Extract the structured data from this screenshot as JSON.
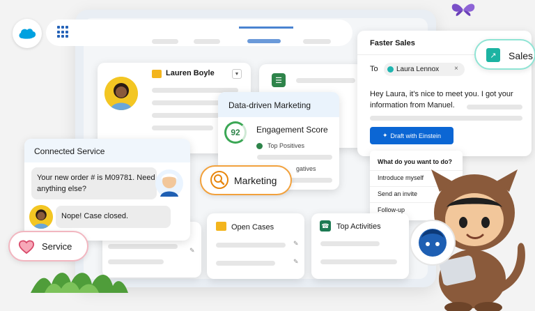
{
  "contact": {
    "name": "Lauren Boyle"
  },
  "marketing_card": {
    "title": "Data-driven Marketing",
    "score": "92",
    "score_label": "Engagement Score",
    "positives_label": "Top Positives",
    "negatives_label": "gatives"
  },
  "sales_email": {
    "title": "Faster Sales",
    "to_label": "To",
    "recipient": "Laura Lennox",
    "close_glyph": "×",
    "body": "Hey Laura, it's nice to meet you. I got your information from Manuel.",
    "draft_button": "Draft with Einstein"
  },
  "sales_badge": {
    "label": "Sales"
  },
  "einstein_menu": {
    "question": "What do you want to do?",
    "options": [
      "Introduce myself",
      "Send an invite",
      "Follow-up"
    ]
  },
  "connected_service": {
    "title": "Connected Service",
    "incoming_message": "Your new order # is M09781. Need anything else?",
    "outgoing_message": "Nope! Case closed."
  },
  "service_badge": {
    "label": "Service"
  },
  "marketing_badge": {
    "label": "Marketing"
  },
  "bottom_cards": {
    "open_cases": "Open Cases",
    "top_activities": "Top Activities"
  },
  "colors": {
    "brand_blue": "#0b66d4",
    "sales_accent": "#1cb3a2",
    "marketing_accent": "#f2a13c",
    "service_accent": "#d84a6a",
    "score_green": "#2e844a"
  },
  "icons": [
    "cloud-logo-icon",
    "app-launcher-icon",
    "checklist-icon",
    "sparkle-icon",
    "chart-icon",
    "magnifier-icon",
    "heart-icon",
    "folder-icon",
    "phone-icon",
    "pencil-icon"
  ]
}
